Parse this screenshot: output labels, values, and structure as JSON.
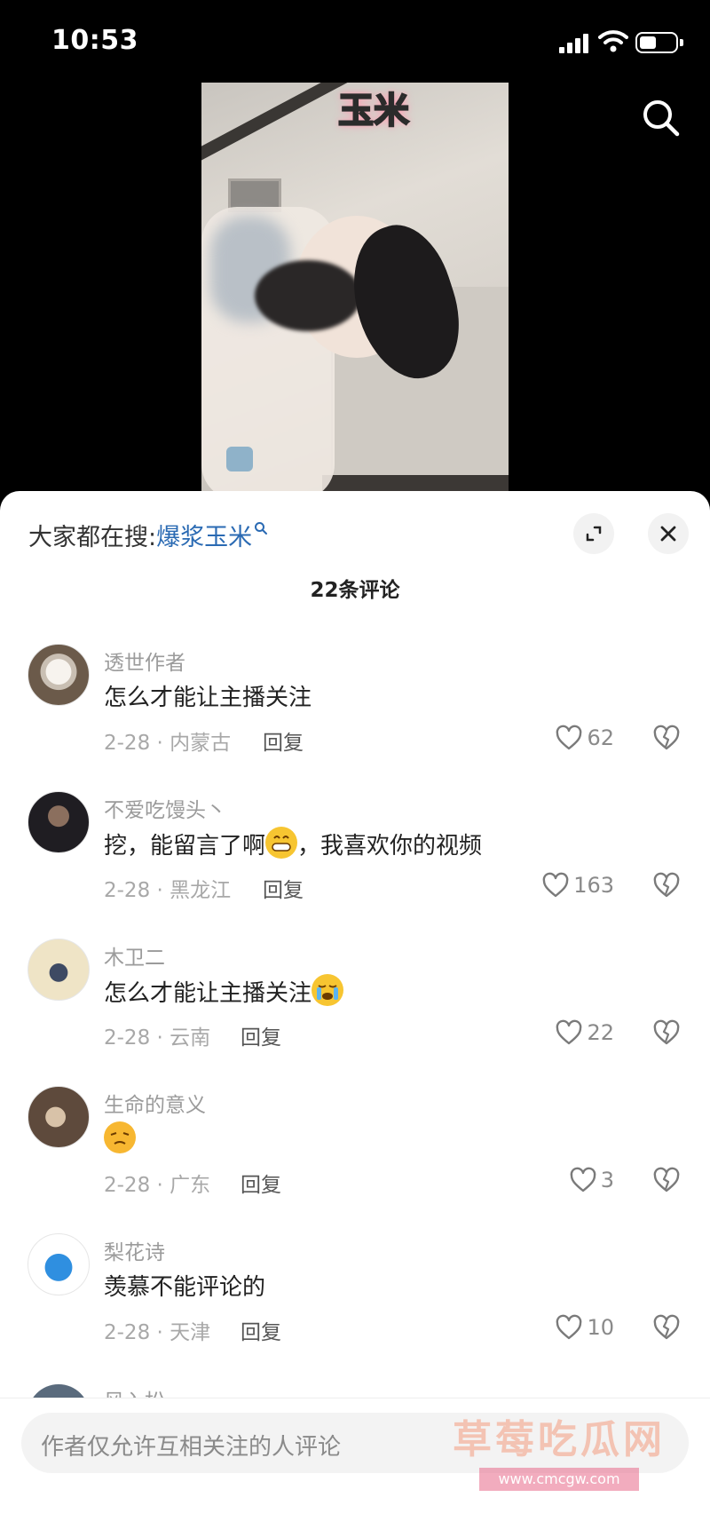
{
  "status_bar": {
    "time": "10:53"
  },
  "video": {
    "caption": "玉米"
  },
  "sheet": {
    "trending_label": "大家都在搜:",
    "trending_term": "爆浆玉米",
    "comment_count": "22条评论"
  },
  "comments": [
    {
      "username": "透世作者",
      "text": "怎么才能让主播关注",
      "meta": "2-28 · 内蒙古",
      "reply": "回复",
      "likes": "62"
    },
    {
      "username": "不爱吃馒头丶",
      "text_before": "挖，能留言了啊",
      "text_after": "，我喜欢你的视频",
      "emoji": "grinning-face",
      "meta": "2-28 · 黑龙江",
      "reply": "回复",
      "likes": "163"
    },
    {
      "username": "木卫二",
      "text": "怎么才能让主播关注",
      "emoji": "crying-face",
      "meta": "2-28 · 云南",
      "reply": "回复",
      "likes": "22"
    },
    {
      "username": "生命的意义",
      "text": "",
      "emoji": "frustrated-face",
      "meta": "2-28 · 广东",
      "reply": "回复",
      "likes": "3"
    },
    {
      "username": "梨花诗",
      "text": "羡慕不能评论的",
      "meta": "2-28 · 天津",
      "reply": "回复",
      "likes": "10"
    },
    {
      "username": "风入松"
    }
  ],
  "input": {
    "placeholder": "作者仅允许互相关注的人评论"
  },
  "watermark": {
    "text": "草莓吃瓜网",
    "url": "www.cmcgw.com"
  },
  "colors": {
    "accent_link": "#2a6ab3",
    "watermark": "#f4a48a"
  }
}
